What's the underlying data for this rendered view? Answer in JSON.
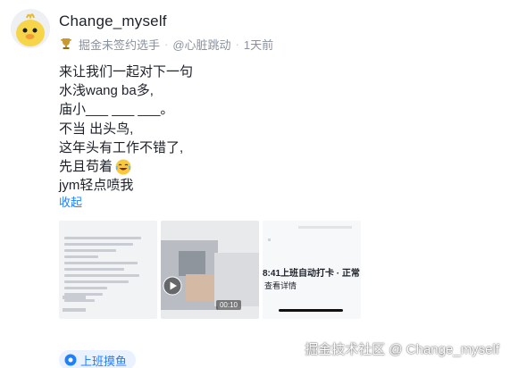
{
  "post": {
    "username": "Change_myself",
    "badge": "掘金未签约选手",
    "topic_tag": "@心脏跳动",
    "separator": "·",
    "time_ago": "1天前",
    "content_lines": [
      "来让我们一起对下一句",
      "水浅wang ba多,",
      "庙小___ ___ ___。",
      "不当 出头鸟,",
      "这年头有工作不错了,",
      "先且苟着",
      "jym轻点喷我"
    ],
    "collapse_label": "收起",
    "thumbnails": [
      {
        "type": "image",
        "icon": "document-screenshot"
      },
      {
        "type": "video",
        "duration": "00:10"
      },
      {
        "type": "image",
        "caption": "8:41上班自动打卡 · 正常",
        "sub": "查看详情"
      }
    ],
    "topic_chip": "上班摸鱼",
    "watermark": "掘金技术社区 @ Change_myself"
  },
  "colors": {
    "accent": "#1e80ff",
    "muted": "#8a919f",
    "text": "#1d2129"
  }
}
